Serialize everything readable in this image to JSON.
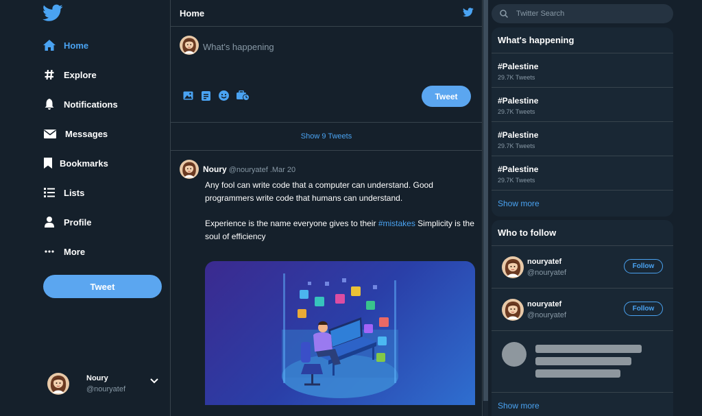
{
  "sidebar": {
    "logo_icon": "twitter-bird-icon",
    "nav": [
      {
        "label": "Home",
        "icon": "home-icon",
        "active": true
      },
      {
        "label": "Explore",
        "icon": "hashtag-icon"
      },
      {
        "label": "Notifications",
        "icon": "bell-icon"
      },
      {
        "label": "Messages",
        "icon": "envelope-icon"
      },
      {
        "label": "Bookmarks",
        "icon": "bookmark-icon"
      },
      {
        "label": "Lists",
        "icon": "list-icon"
      },
      {
        "label": "Profile",
        "icon": "user-icon"
      },
      {
        "label": "More",
        "icon": "more-dots-icon"
      }
    ],
    "tweet_button": "Tweet",
    "account": {
      "name": "Noury",
      "handle": "@nouryatef"
    }
  },
  "main": {
    "title": "Home",
    "compose": {
      "placeholder": "What's happening",
      "tweet_button": "Tweet"
    },
    "show_tweets": "Show 9 Tweets",
    "tweet": {
      "name": "Noury",
      "handle_date": "@nouryatef .Mar 20",
      "para1": "Any fool can write code that a computer can understand. Good programmers write code that humans can understand.",
      "para2_before": "Experience is the name everyone gives to their ",
      "para2_tag": "#mistakes",
      "para2_after": " Simplicity is the soul of efficiency"
    }
  },
  "right": {
    "search_placeholder": "Twitter Search",
    "trends_title": "What's happening",
    "trends": [
      {
        "tag": "#Palestine",
        "count": "29.7K Tweets"
      },
      {
        "tag": "#Palestine",
        "count": "29.7K Tweets"
      },
      {
        "tag": "#Palestine",
        "count": "29.7K Tweets"
      },
      {
        "tag": "#Palestine",
        "count": "29.7K Tweets"
      }
    ],
    "trends_show_more": "Show more",
    "follow_title": "Who to follow",
    "follow": [
      {
        "name": "nouryatef",
        "handle": "@nouryatef",
        "button": "Follow"
      },
      {
        "name": "nouryatef",
        "handle": "@nouryatef",
        "button": "Follow"
      }
    ],
    "follow_show_more": "Show more"
  },
  "colors": {
    "background": "#15202b",
    "accent": "#4aa3f2",
    "button": "#5ba6f0",
    "panel": "#192734",
    "border": "#38444d"
  }
}
